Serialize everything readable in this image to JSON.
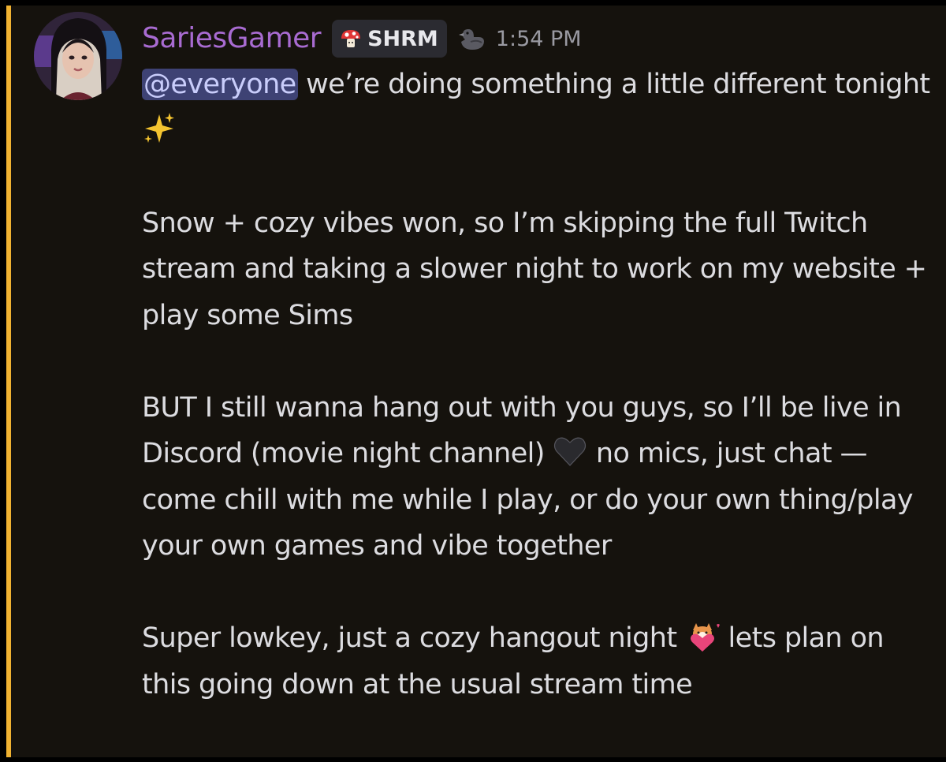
{
  "message": {
    "author": "SariesGamer",
    "tag_label": "SHRM",
    "timestamp": "1:54 PM",
    "mention": "@everyone",
    "p1_text": " we’re doing something a little different tonight ",
    "p2": "Snow + cozy vibes won, so I’m skipping the full Twitch stream and taking a slower night to work on my website + play some Sims",
    "p3a": "BUT I still wanna hang out with you guys, so I’ll be live in Discord (movie night channel) ",
    "p3b": " no mics, just chat — come chill with me while I play, or do your own thing/play your own games and vibe together",
    "p4a": "Super lowkey, just a cozy hangout night ",
    "p4b": " lets plan on this going down at the usual stream time"
  },
  "icons": {
    "tag_icon": "mushroom-icon",
    "role_icon": "duck-icon",
    "emoji1": "sparkles-emoji",
    "emoji2": "black-heart-emoji",
    "emoji3": "corgi-heart-emoji"
  },
  "colors": {
    "accent_bar": "#f0b232",
    "username": "#a86bd1",
    "mention_bg": "#3e4274",
    "background": "#15120d"
  }
}
